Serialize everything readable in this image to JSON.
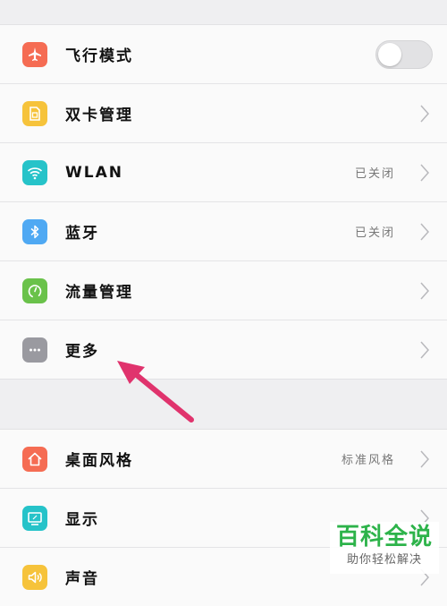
{
  "colors": {
    "airplane": "#f56c53",
    "sim": "#f6c33b",
    "wlan": "#26c3c9",
    "bluetooth": "#4fa9f3",
    "data": "#6ac24a",
    "more": "#9a9aa0",
    "theme": "#f56c53",
    "display": "#26c3c9",
    "sound": "#f6c33b",
    "annotation_arrow": "#e0336d",
    "watermark": "#2db34a"
  },
  "group1": [
    {
      "label": "飞行模式",
      "icon": "airplane-icon",
      "toggle": false
    },
    {
      "label": "双卡管理",
      "icon": "sim-card-icon",
      "value": ""
    },
    {
      "label": "WLAN",
      "icon": "wifi-icon",
      "value": "已关闭"
    },
    {
      "label": "蓝牙",
      "icon": "bluetooth-icon",
      "value": "已关闭"
    },
    {
      "label": "流量管理",
      "icon": "data-usage-icon",
      "value": ""
    },
    {
      "label": "更多",
      "icon": "more-icon",
      "value": ""
    }
  ],
  "group2": [
    {
      "label": "桌面风格",
      "icon": "home-icon",
      "value": "标准风格"
    },
    {
      "label": "显示",
      "icon": "display-icon",
      "value": ""
    },
    {
      "label": "声音",
      "icon": "sound-icon",
      "value": ""
    }
  ],
  "watermark": {
    "title": "百科全说",
    "subtitle": "助你轻松解决"
  }
}
